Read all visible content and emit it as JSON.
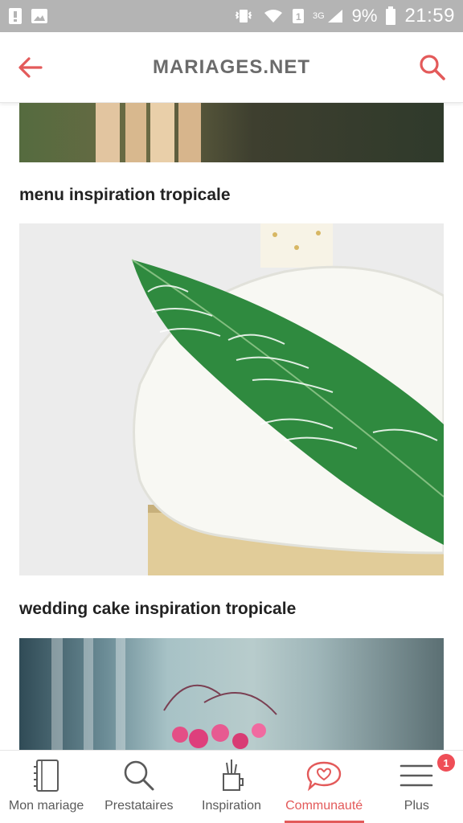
{
  "status_bar": {
    "battery_percent": "9%",
    "time": "21:59",
    "network": "3G",
    "sim": "1",
    "icons": [
      "notification-icon",
      "gallery-icon",
      "vibrate-icon",
      "wifi-icon",
      "sim-icon",
      "signal-icon",
      "battery-icon"
    ]
  },
  "app_bar": {
    "title": "MARIAGES.NET",
    "back_icon": "back-arrow-icon",
    "search_icon": "search-icon"
  },
  "content": {
    "items": [
      {
        "caption": "menu inspiration tropicale",
        "image_name": "menu-image"
      },
      {
        "caption": "wedding cake inspiration tropicale",
        "image_name": "cake-image"
      }
    ]
  },
  "bottom_nav": {
    "items": [
      {
        "label": "Mon mariage",
        "icon": "notebook-icon"
      },
      {
        "label": "Prestataires",
        "icon": "search-icon"
      },
      {
        "label": "Inspiration",
        "icon": "pencil-cup-icon"
      },
      {
        "label": "Communauté",
        "icon": "chat-heart-icon"
      },
      {
        "label": "Plus",
        "icon": "menu-icon"
      }
    ],
    "badge_count": "1",
    "active_color": "#e35a5a"
  },
  "colors": {
    "accent": "#e35a5a",
    "status_bar_bg": "#b4b4b4",
    "badge": "#ef4e57"
  }
}
